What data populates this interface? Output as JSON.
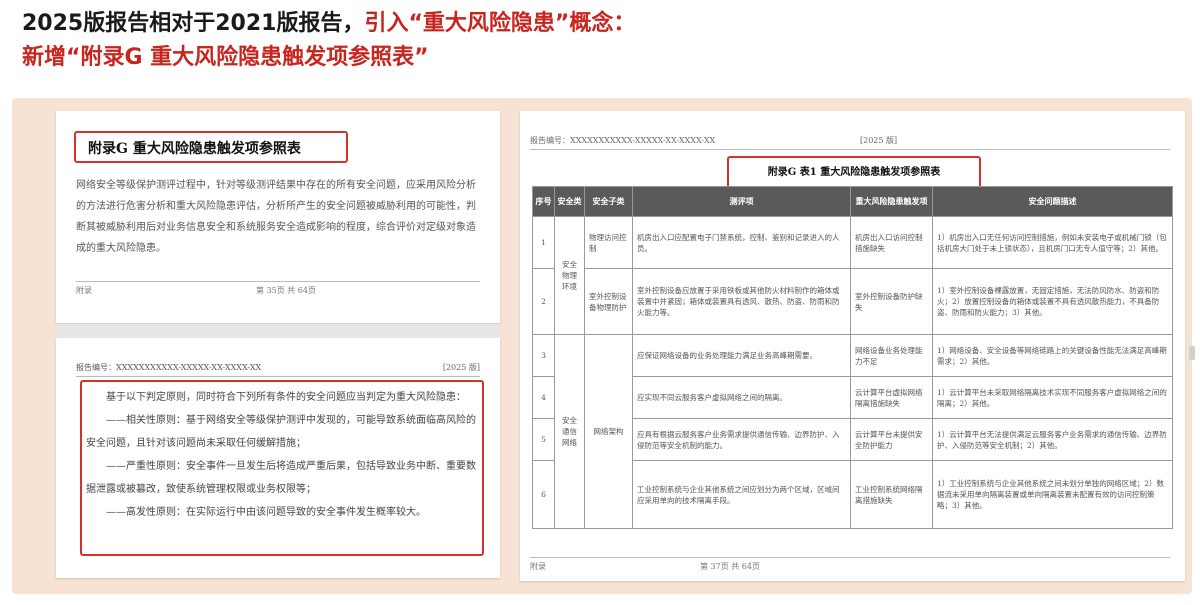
{
  "header": {
    "line1_part1": "2025版报告相对于2021版报告，",
    "line1_part2": "引入“重大风险隐患”概念：",
    "line2": "新增“附录G 重大风险隐患触发项参照表”"
  },
  "colors": {
    "accent": "#c8251f",
    "stage_bg": "#f6e3d3",
    "table_header_bg": "#5a5a5a"
  },
  "left_top_page": {
    "heading": "附录G   重大风险隐患触发项参照表",
    "paragraph": "网络安全等级保护测评过程中，针对等级测评结果中存在的所有安全问题，应采用风险分析的方法进行危害分析和重大风险隐患评估，分析所产生的安全问题被威胁利用的可能性，判断其被威胁利用后对业务信息安全和系统服务安全造成影响的程度，综合评价对定级对象造成的重大风险隐患。",
    "footer_left": "附录",
    "footer_page": "第 35页 共 64页"
  },
  "left_bottom_page": {
    "doc_no": "报告编号：XXXXXXXXXXX-XXXXX-XX-XXXX-XX",
    "version": "[2025 版]",
    "intro": "基于以下判定原则，同时符合下列所有条件的安全问题应当判定为重大风险隐患：",
    "p1": "——相关性原则：基于网络安全等级保护测评中发现的，可能导致系统面临高风险的安全问题，且针对该问题尚未采取任何缓解措施；",
    "p2": "——严重性原则：安全事件一旦发生后将造成严重后果，包括导致业务中断、重要数据泄露或被篡改，致使系统管理权限或业务权限等；",
    "p3": "——高发性原则：在实际运行中由该问题导致的安全事件发生概率较大。"
  },
  "right_page": {
    "doc_no": "报告编号：XXXXXXXXXXX-XXXXX-XX-XXXX-XX",
    "version": "[2025 版]",
    "caption": "附录G 表1 重大风险隐患触发项参照表",
    "columns": [
      "序号",
      "安全类",
      "安全子类",
      "测评项",
      "重大风险隐患触发项",
      "安全问题描述"
    ],
    "rows": [
      {
        "no": "1",
        "sub": "物理访问控制",
        "item": "机房出入口应配置电子门禁系统，控制、鉴别和记录进入的人员。",
        "trigger": "机房出入口访问控制措施缺失",
        "desc": "1）机房出入口无任何访问控制措施，例如未安装电子或机械门锁（包括机房大门处于未上锁状态），且机房门口无专人值守等；2）其他。"
      },
      {
        "no": "2",
        "sub": "室外控制设备物理防护",
        "item": "室外控制设备应放置于采用铁板或其他防火材料制作的箱体或装置中并紧固；箱体或装置具有透风、散热、防盗、防雨和防火能力等。",
        "trigger": "室外控制设备防护缺失",
        "desc": "1）室外控制设备裸露放置，无固定措施，无法防风防水、防盗和防火；2）放置控制设备的箱体或装置不具有透风散热能力，不具备防盗、防雨和防火能力；3）其他。"
      },
      {
        "no": "3",
        "sub": "",
        "item": "应保证网络设备的业务处理能力满足业务高峰期需要。",
        "trigger": "网络设备业务处理能力不足",
        "desc": "1）网络设备、安全设备等网络链路上的关键设备性能无法满足高峰期需求；2）其他。"
      },
      {
        "no": "4",
        "sub": "",
        "item": "应实现不同云服务客户虚拟网络之间的隔离。",
        "trigger": "云计算平台虚拟网络隔离措施缺失",
        "desc": "1）云计算平台未采取网络隔离技术实现不同服务客户虚拟网络之间的隔离；2）其他。"
      },
      {
        "no": "5",
        "sub": "",
        "item": "应具有根据云服务客户业务需求提供通信传输、边界防护、入侵防范等安全机制的能力。",
        "trigger": "云计算平台未提供安全防护能力",
        "desc": "1）云计算平台无法提供满足云服务客户业务需求的通信传输、边界防护、入侵防范等安全机制；2）其他。"
      },
      {
        "no": "6",
        "sub": "",
        "item": "工业控制系统与企业其他系统之间应划分为两个区域，区域间应采用单向的技术隔离手段。",
        "trigger": "工业控制系统网络隔离措施缺失",
        "desc": "1）工业控制系统与企业其他系统之间未划分单独的网络区域；2）数据流未采用单向隔离装置或单向隔离装置未配置有效的访问控制策略；3）其他。"
      }
    ],
    "cat_physical": "安全物理环境",
    "cat_network": "安全通信网络",
    "sub_network": "网络架构",
    "footer_left": "附录",
    "footer_page": "第 37页 共 64页"
  }
}
